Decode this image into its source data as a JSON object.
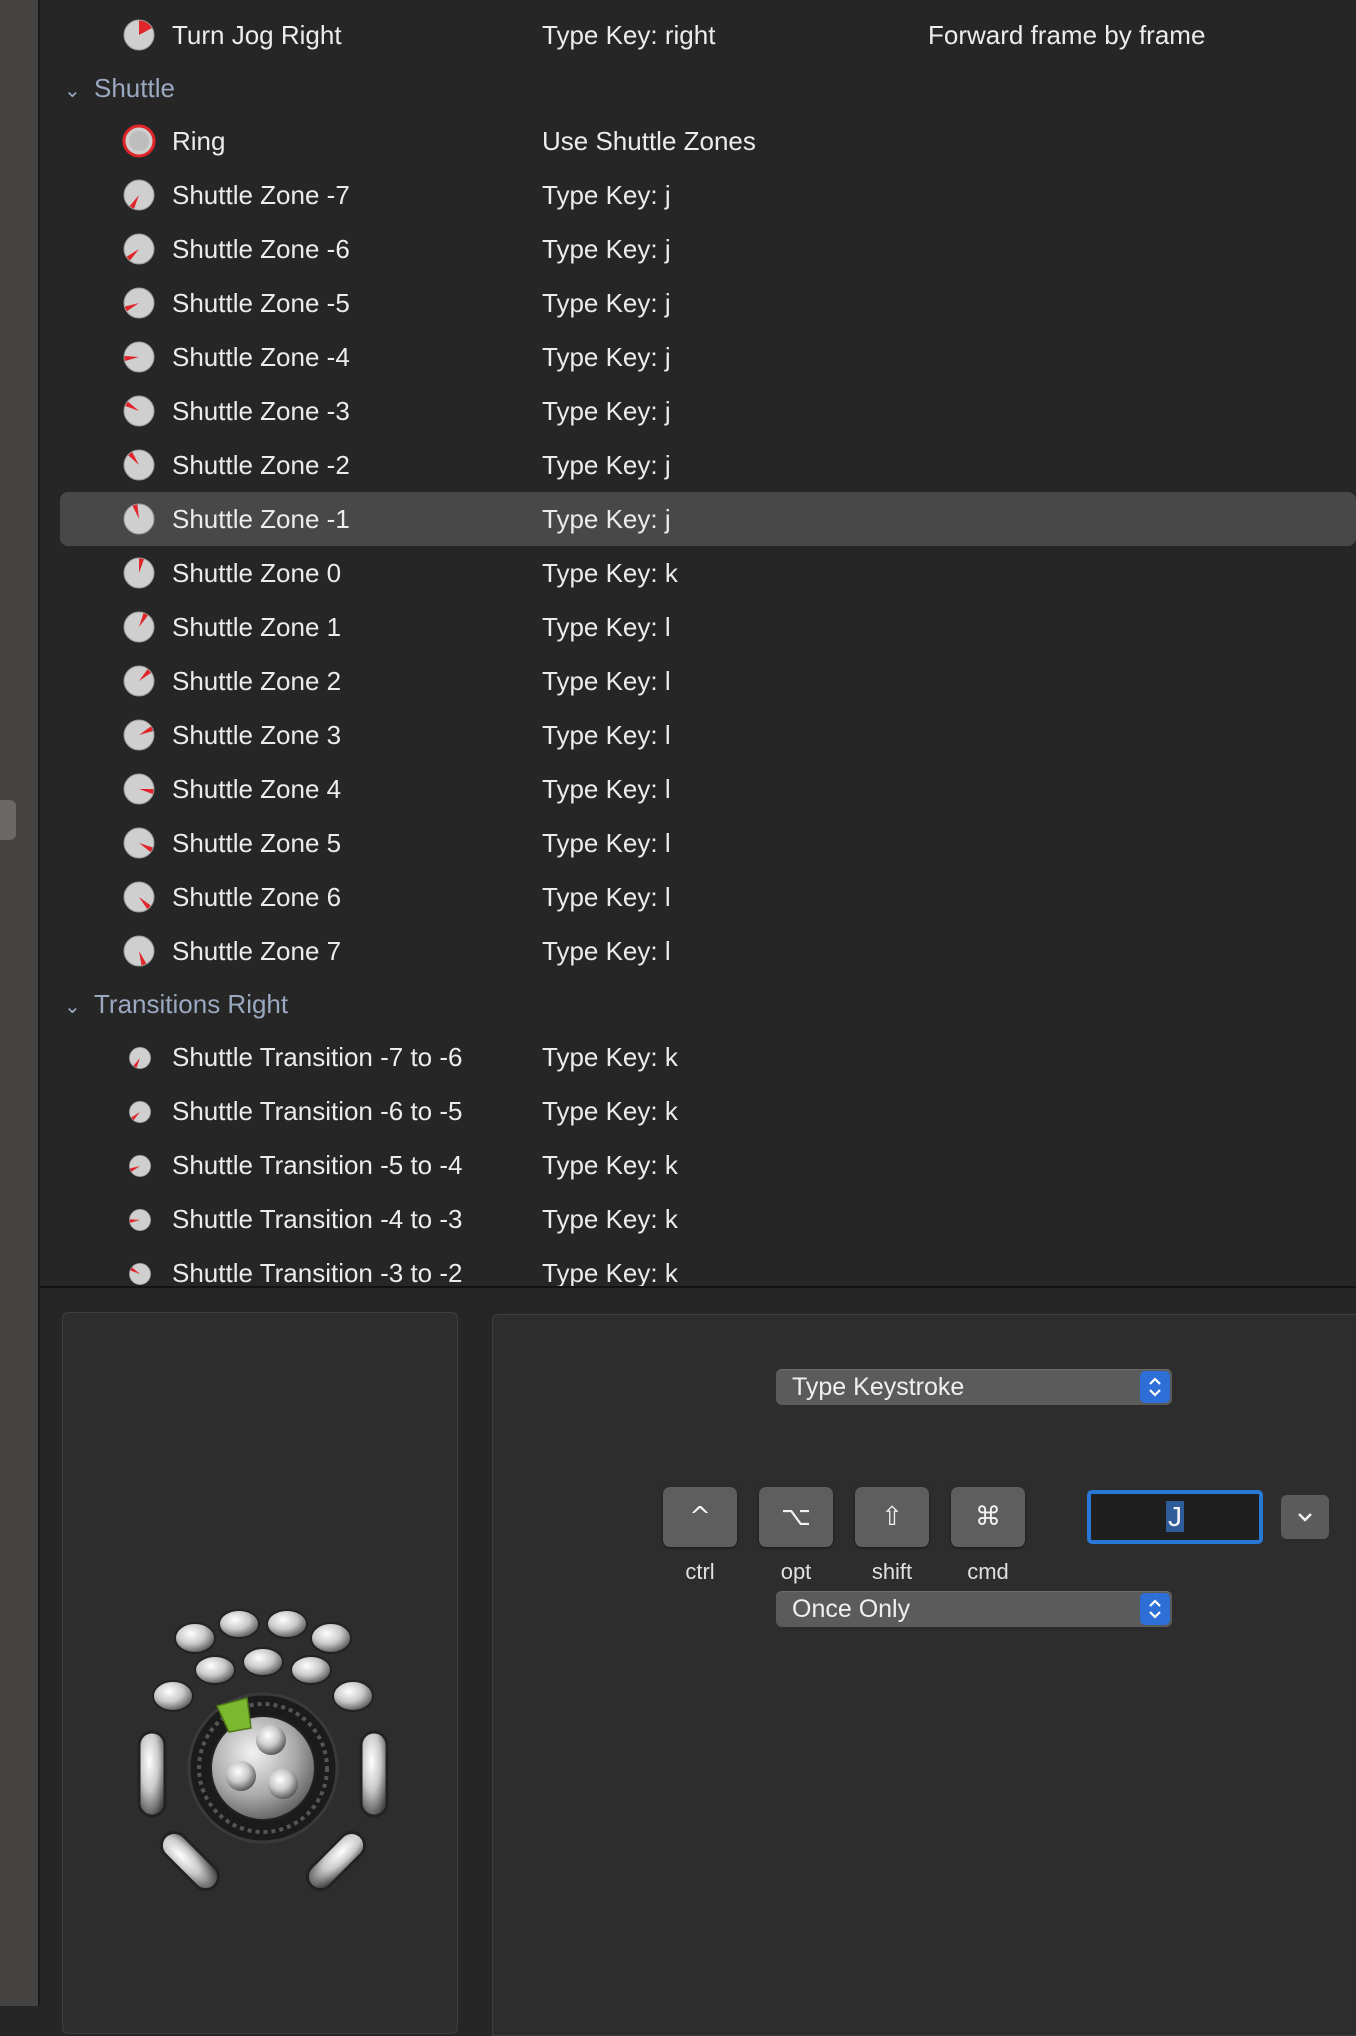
{
  "list": {
    "rows": [
      {
        "kind": "item",
        "name": "Turn Jog Right",
        "action": "Type Key: right",
        "description": "Forward frame by frame",
        "icon": "jog-right-dial-icon"
      },
      {
        "kind": "section",
        "label": "Shuttle"
      },
      {
        "kind": "item",
        "name": "Ring",
        "action": "Use Shuttle Zones",
        "icon": "ring-dial-icon"
      },
      {
        "kind": "item",
        "name": "Shuttle Zone -7",
        "action": "Type Key: j",
        "icon": "shuttle-zone-dial-icon"
      },
      {
        "kind": "item",
        "name": "Shuttle Zone -6",
        "action": "Type Key: j",
        "icon": "shuttle-zone-dial-icon"
      },
      {
        "kind": "item",
        "name": "Shuttle Zone -5",
        "action": "Type Key: j",
        "icon": "shuttle-zone-dial-icon"
      },
      {
        "kind": "item",
        "name": "Shuttle Zone -4",
        "action": "Type Key: j",
        "icon": "shuttle-zone-dial-icon"
      },
      {
        "kind": "item",
        "name": "Shuttle Zone -3",
        "action": "Type Key: j",
        "icon": "shuttle-zone-dial-icon"
      },
      {
        "kind": "item",
        "name": "Shuttle Zone -2",
        "action": "Type Key: j",
        "icon": "shuttle-zone-dial-icon"
      },
      {
        "kind": "item",
        "name": "Shuttle Zone -1",
        "action": "Type Key: j",
        "icon": "shuttle-zone-dial-icon",
        "selected": true
      },
      {
        "kind": "item",
        "name": "Shuttle Zone 0",
        "action": "Type Key: k",
        "icon": "shuttle-zone-dial-icon"
      },
      {
        "kind": "item",
        "name": "Shuttle Zone 1",
        "action": "Type Key: l",
        "icon": "shuttle-zone-dial-icon"
      },
      {
        "kind": "item",
        "name": "Shuttle Zone 2",
        "action": "Type Key: l",
        "icon": "shuttle-zone-dial-icon"
      },
      {
        "kind": "item",
        "name": "Shuttle Zone 3",
        "action": "Type Key: l",
        "icon": "shuttle-zone-dial-icon"
      },
      {
        "kind": "item",
        "name": "Shuttle Zone 4",
        "action": "Type Key: l",
        "icon": "shuttle-zone-dial-icon"
      },
      {
        "kind": "item",
        "name": "Shuttle Zone 5",
        "action": "Type Key: l",
        "icon": "shuttle-zone-dial-icon"
      },
      {
        "kind": "item",
        "name": "Shuttle Zone 6",
        "action": "Type Key: l",
        "icon": "shuttle-zone-dial-icon"
      },
      {
        "kind": "item",
        "name": "Shuttle Zone 7",
        "action": "Type Key: l",
        "icon": "shuttle-zone-dial-icon"
      },
      {
        "kind": "section",
        "label": "Transitions Right"
      },
      {
        "kind": "item",
        "name": "Shuttle Transition -7 to -6",
        "action": "Type Key: k",
        "icon": "shuttle-transition-dial-icon"
      },
      {
        "kind": "item",
        "name": "Shuttle Transition -6 to -5",
        "action": "Type Key: k",
        "icon": "shuttle-transition-dial-icon"
      },
      {
        "kind": "item",
        "name": "Shuttle Transition -5 to -4",
        "action": "Type Key: k",
        "icon": "shuttle-transition-dial-icon"
      },
      {
        "kind": "item",
        "name": "Shuttle Transition -4 to -3",
        "action": "Type Key: k",
        "icon": "shuttle-transition-dial-icon"
      },
      {
        "kind": "item",
        "name": "Shuttle Transition -3 to -2",
        "action": "Type Key: k",
        "icon": "shuttle-transition-dial-icon"
      }
    ]
  },
  "editor": {
    "action_type": "Type Keystroke",
    "modifiers": [
      {
        "glyph": "^",
        "label": "ctrl",
        "icon": "control-key-icon"
      },
      {
        "glyph": "⌥",
        "label": "opt",
        "icon": "option-key-icon"
      },
      {
        "glyph": "⇧",
        "label": "shift",
        "icon": "shift-key-icon"
      },
      {
        "glyph": "⌘",
        "label": "cmd",
        "icon": "command-key-icon"
      }
    ],
    "key_value": "J",
    "repeat_mode": "Once Only"
  },
  "colors": {
    "accent": "#2d6fd6",
    "indicator_red": "#e0262a",
    "selected_button": "#7cb82f"
  }
}
